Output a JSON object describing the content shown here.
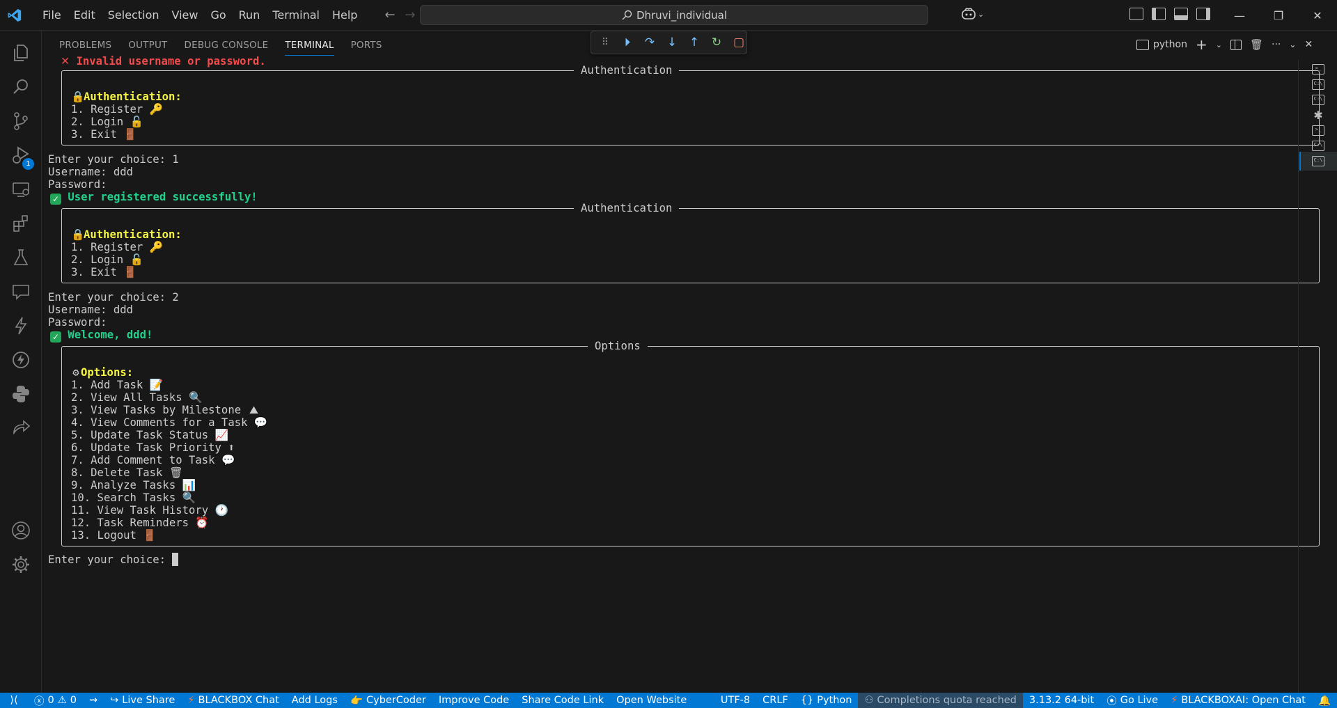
{
  "menu": [
    "File",
    "Edit",
    "Selection",
    "View",
    "Go",
    "Run",
    "Terminal",
    "Help"
  ],
  "search": {
    "text": "Dhruvi_individual"
  },
  "activity_badge": "1",
  "panel_tabs": [
    "PROBLEMS",
    "OUTPUT",
    "DEBUG CONSOLE",
    "TERMINAL",
    "PORTS"
  ],
  "terminal_name": "python",
  "terminal": {
    "error_line": "Invalid username or password.",
    "box_auth_title": "Authentication",
    "box_options_title": "Options",
    "auth_heading": "Authentication:",
    "auth_items": [
      "1. Register",
      "2. Login",
      "3. Exit"
    ],
    "choice_prompt": "Enter your choice: ",
    "choice1": "1",
    "username_prompt": "Username: ",
    "username1": "ddd",
    "password_prompt": "Password:",
    "registered": "User registered successfully!",
    "choice2": "2",
    "username2": "ddd",
    "welcome": "Welcome, ddd!",
    "options_heading": "Options:",
    "options_items": [
      "1. Add Task",
      "2. View All Tasks",
      "3. View Tasks by Milestone",
      "4. View Comments for a Task",
      "5. Update Task Status",
      "6. Update Task Priority",
      "7. Add Comment to Task",
      "8. Delete Task",
      "9. Analyze Tasks",
      "10. Search Tasks",
      "11. View Task History",
      "12. Task Reminders",
      "13. Logout"
    ],
    "final_prompt": "Enter your choice: "
  },
  "status": {
    "errors": "0",
    "warnings": "0",
    "live_share": "Live Share",
    "blackbox_chat": "BLACKBOX Chat",
    "add_logs": "Add Logs",
    "cybercoder": "CyberCoder",
    "improve_code": "Improve Code",
    "share_code_link": "Share Code Link",
    "open_website": "Open Website",
    "encoding": "UTF-8",
    "eol": "CRLF",
    "language": "Python",
    "quota": "Completions quota reached",
    "interpreter": "3.13.2 64-bit",
    "go_live": "Go Live",
    "blackboxai_chat": "BLACKBOXAI: Open Chat"
  },
  "colors": {
    "accent": "#0078d4",
    "error": "#f14c4c",
    "success": "#23d18b",
    "heading": "#f5f543"
  }
}
